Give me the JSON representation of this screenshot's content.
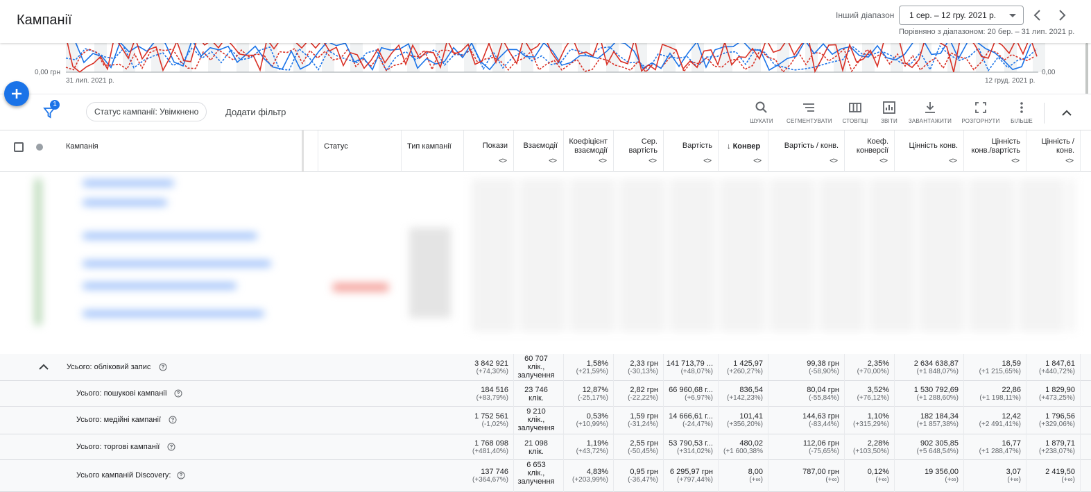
{
  "header": {
    "title": "Кампанії",
    "range_label": "Інший діапазон",
    "date_range": "1 сер. – 12 гру. 2021 р.",
    "compare_text": "Порівняно з діапазоном: 20 бер. – 31 лип. 2021 р."
  },
  "chart": {
    "y_left_min": "0,00 грн",
    "y_right_min": "0,00",
    "x_start": "31 лип. 2021 р.",
    "x_end": "12 груд. 2021 р.",
    "colors": {
      "blue": "#1a73e8",
      "red": "#d93025"
    }
  },
  "toolbar": {
    "filter_badge": "1",
    "status_chip": "Статус кампанії: Увімкнено",
    "add_filter": "Додати фільтр",
    "tools": [
      {
        "label": "ШУКАТИ",
        "icon": "search-icon"
      },
      {
        "label": "СЕГМЕНТУВАТИ",
        "icon": "segment-icon"
      },
      {
        "label": "СТОВПЦІ",
        "icon": "columns-icon"
      },
      {
        "label": "ЗВІТИ",
        "icon": "reports-icon"
      },
      {
        "label": "ЗАВАНТАЖИТИ",
        "icon": "download-icon"
      },
      {
        "label": "РОЗГОРНУТИ",
        "icon": "expand-icon"
      },
      {
        "label": "БІЛЬШЕ",
        "icon": "more-icon"
      }
    ]
  },
  "table": {
    "columns": {
      "campaign": "Кампанія",
      "status": "Статус",
      "type": "Тип кампанії",
      "impressions": "Покази",
      "interactions": "Взаємодії",
      "interaction_rate_1": "Коефіцієнт",
      "interaction_rate_2": "взаємодії",
      "avg_cost_1": "Сер.",
      "avg_cost_2": "вартість",
      "cost": "Вартість",
      "conversions": "Конвер",
      "cost_per_conv": "Вартість / конв.",
      "conv_rate_1": "Коеф.",
      "conv_rate_2": "конверсії",
      "conv_value": "Цінність конв.",
      "conv_value_cost_1": "Цінність",
      "conv_value_cost_2": "конв./вартість",
      "value_per_conv_1": "Цінність /",
      "value_per_conv_2": "конв."
    },
    "sorter": "<>",
    "sort_arrow": "↓",
    "totals": [
      {
        "name": "Усього: обліковий запис",
        "impressions": "3 842 921",
        "impressions_d": "(+74,30%)",
        "interactions_1": "60 707",
        "interactions_2": "клік.,",
        "interactions_3": "залучення",
        "int_rate": "1,58%",
        "int_rate_d": "(+21,59%)",
        "avg_cost": "2,33 грн",
        "avg_cost_d": "(-30,13%)",
        "cost": "141 713,79 ...",
        "cost_d": "(+48,07%)",
        "conv": "1 425,97",
        "conv_d": "(+260,27%)",
        "cpc": "99,38 грн",
        "cpc_d": "(-58,90%)",
        "conv_rate": "2,35%",
        "conv_rate_d": "(+70,00%)",
        "conv_value": "2 634 638,87",
        "conv_value_d": "(+1 848,07%)",
        "value_cost": "18,59",
        "value_cost_d": "(+1 215,65%)",
        "vpc": "1 847,61",
        "vpc_d": "(+440,72%)"
      },
      {
        "name": "Усього: пошукові кампанії",
        "impressions": "184 516",
        "impressions_d": "(+83,79%)",
        "interactions_1": "23 746",
        "interactions_2": "клік.",
        "interactions_3": "",
        "int_rate": "12,87%",
        "int_rate_d": "(-25,17%)",
        "avg_cost": "2,82 грн",
        "avg_cost_d": "(-22,22%)",
        "cost": "66 960,68 г...",
        "cost_d": "(+6,97%)",
        "conv": "836,54",
        "conv_d": "(+142,23%)",
        "cpc": "80,04 грн",
        "cpc_d": "(-55,84%)",
        "conv_rate": "3,52%",
        "conv_rate_d": "(+76,12%)",
        "conv_value": "1 530 792,69",
        "conv_value_d": "(+1 288,60%)",
        "value_cost": "22,86",
        "value_cost_d": "(+1 198,11%)",
        "vpc": "1 829,90",
        "vpc_d": "(+473,25%)"
      },
      {
        "name": "Усього: медійні кампанії",
        "impressions": "1 752 561",
        "impressions_d": "(-1,02%)",
        "interactions_1": "9 210",
        "interactions_2": "клік.,",
        "interactions_3": "залучення",
        "int_rate": "0,53%",
        "int_rate_d": "(+10,99%)",
        "avg_cost": "1,59 грн",
        "avg_cost_d": "(-31,24%)",
        "cost": "14 666,61 г...",
        "cost_d": "(-24,47%)",
        "conv": "101,41",
        "conv_d": "(+356,20%)",
        "cpc": "144,63 грн",
        "cpc_d": "(-83,44%)",
        "conv_rate": "1,10%",
        "conv_rate_d": "(+315,29%)",
        "conv_value": "182 184,34",
        "conv_value_d": "(+1 857,38%)",
        "value_cost": "12,42",
        "value_cost_d": "(+2 491,41%)",
        "vpc": "1 796,56",
        "vpc_d": "(+329,06%)"
      },
      {
        "name": "Усього: торгові кампанії",
        "impressions": "1 768 098",
        "impressions_d": "(+481,40%)",
        "interactions_1": "21 098",
        "interactions_2": "клік.",
        "interactions_3": "",
        "int_rate": "1,19%",
        "int_rate_d": "(+43,72%)",
        "avg_cost": "2,55 грн",
        "avg_cost_d": "(-50,45%)",
        "cost": "53 790,53 г...",
        "cost_d": "(+314,02%)",
        "conv": "480,02",
        "conv_d": "(+1 600,38%",
        "cpc": "112,06 грн",
        "cpc_d": "(-75,65%)",
        "conv_rate": "2,28%",
        "conv_rate_d": "(+103,50%)",
        "conv_value": "902 305,85",
        "conv_value_d": "(+5 648,54%)",
        "value_cost": "16,77",
        "value_cost_d": "(+1 288,47%)",
        "vpc": "1 879,71",
        "vpc_d": "(+238,07%)"
      },
      {
        "name": "Усього кампаній Discovery:",
        "impressions": "137 746",
        "impressions_d": "(+364,67%)",
        "interactions_1": "6 653",
        "interactions_2": "клік.,",
        "interactions_3": "залучення",
        "int_rate": "4,83%",
        "int_rate_d": "(+203,99%)",
        "avg_cost": "0,95 грн",
        "avg_cost_d": "(-36,47%)",
        "cost": "6 295,97 грн",
        "cost_d": "(+797,44%)",
        "conv": "8,00",
        "conv_d": "(+∞)",
        "cpc": "787,00 грн",
        "cpc_d": "(+∞)",
        "conv_rate": "0,12%",
        "conv_rate_d": "(+∞)",
        "conv_value": "19 356,00",
        "conv_value_d": "(+∞)",
        "value_cost": "3,07",
        "value_cost_d": "(+∞)",
        "vpc": "2 419,50",
        "vpc_d": "(+∞)"
      }
    ]
  }
}
